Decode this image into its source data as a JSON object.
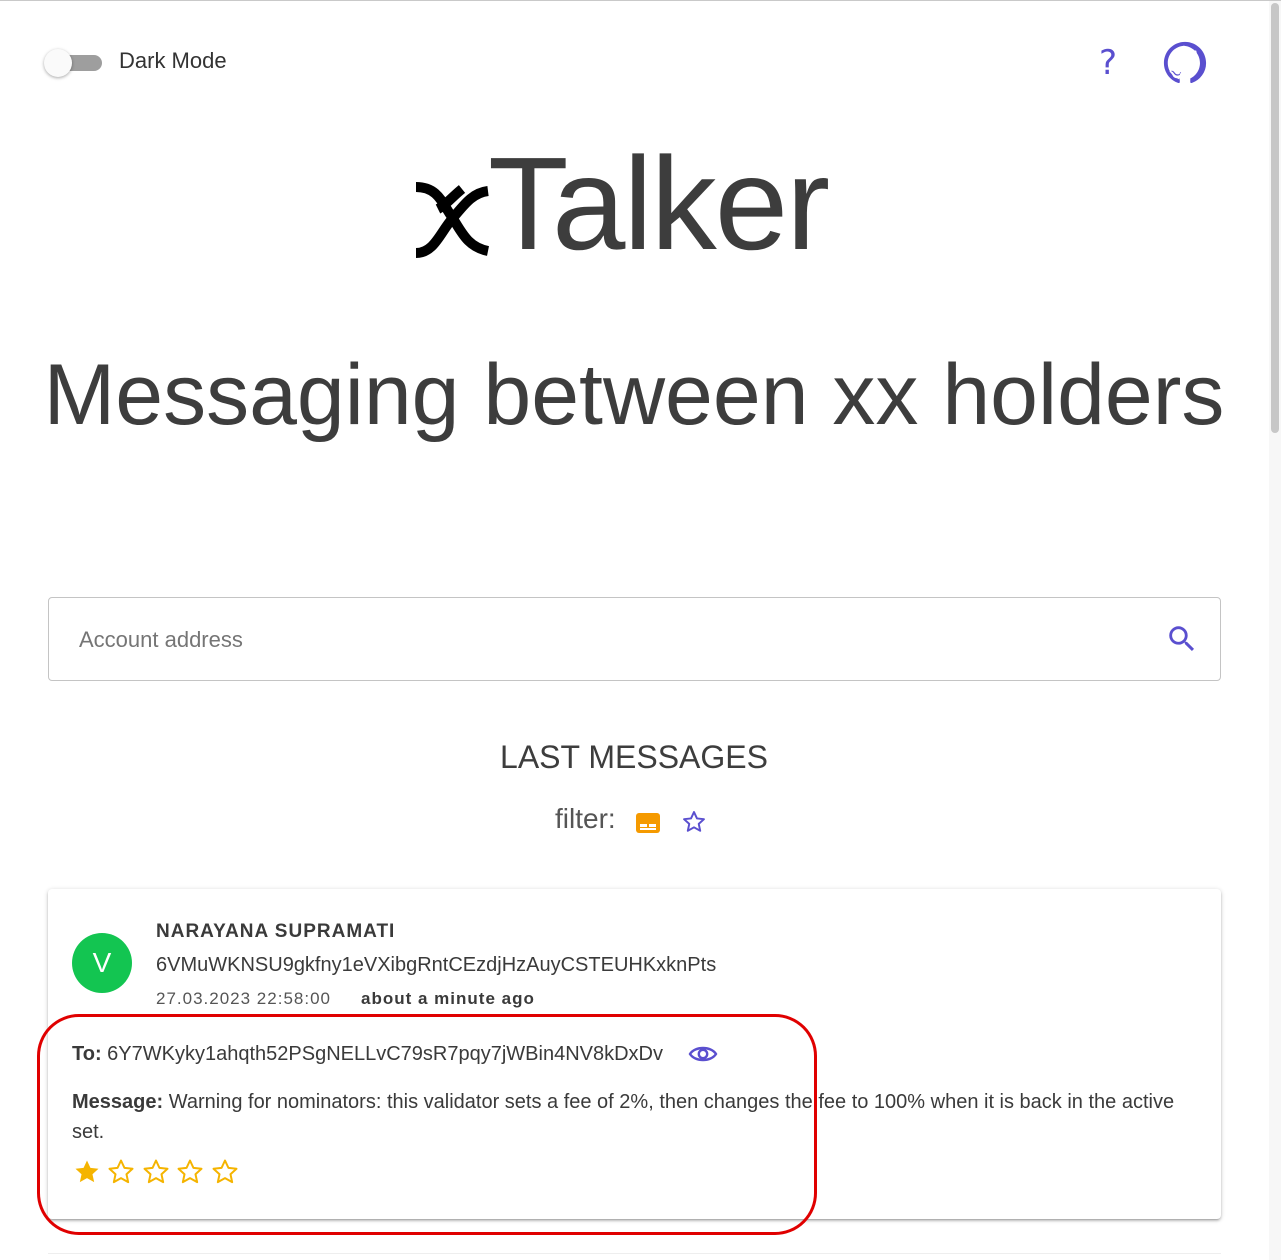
{
  "topbar": {
    "dark_mode_label": "Dark Mode",
    "dark_mode_on": false,
    "help_label": "?"
  },
  "logo": {
    "text": "Talker"
  },
  "headline": "Messaging between xx holders",
  "search": {
    "placeholder": "Account address",
    "value": ""
  },
  "messages_section": {
    "title": "LAST MESSAGES",
    "filter_label": "filter:"
  },
  "message": {
    "avatar_letter": "V",
    "sender_name": "NARAYANA SUPRAMATI",
    "sender_address": "6VMuWKNSU9gkfny1eVXibgRntCEzdjHzAuyCSTEUHKxknPts",
    "timestamp": "27.03.2023 22:58:00",
    "relative_time": "about a minute ago",
    "to_label": "To:",
    "to_address": "6Y7WKyky1ahqth52PSgNELLvC79sR7pqy7jWBin4NV8kDxDv",
    "message_label": "Message:",
    "message_text": "Warning for nominators: this validator sets a fee of 2%, then changes the fee to 100% when it is back in the active set.",
    "rating": 1,
    "rating_max": 5
  },
  "colors": {
    "accent": "#5a4fcf",
    "avatar": "#13c551",
    "star": "#f5b400",
    "filter_msg": "#f59a00",
    "highlight": "#e00000"
  },
  "icons": [
    "help-icon",
    "github-icon",
    "search-icon",
    "message-icon",
    "star-outline-icon",
    "eye-icon",
    "star-icon"
  ]
}
